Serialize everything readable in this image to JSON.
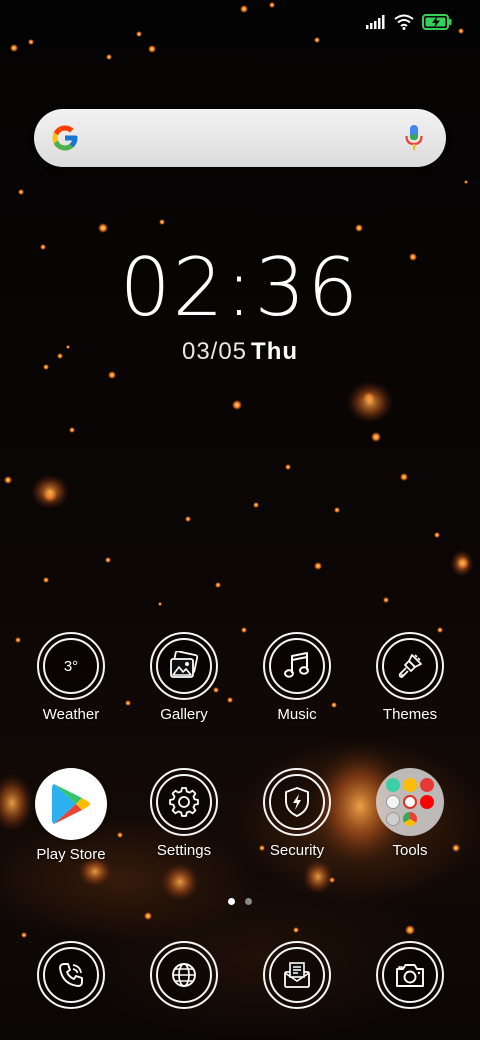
{
  "status_bar": {
    "signal_icon": "signal-bars-icon",
    "wifi_icon": "wifi-icon",
    "battery_icon": "battery-charging-icon",
    "battery_color": "#35d05a"
  },
  "search": {
    "logo_icon": "google-g-icon",
    "mic_icon": "microphone-icon"
  },
  "clock": {
    "time": "02:36",
    "date": "03/05",
    "day": "Thu"
  },
  "apps": {
    "weather": {
      "label": "Weather",
      "icon_text": "3°"
    },
    "gallery": {
      "label": "Gallery",
      "icon": "image-icon"
    },
    "music": {
      "label": "Music",
      "icon": "music-note-icon"
    },
    "themes": {
      "label": "Themes",
      "icon": "paintbrush-icon"
    },
    "playstore": {
      "label": "Play Store",
      "icon": "play-store-icon"
    },
    "settings": {
      "label": "Settings",
      "icon": "gear-icon"
    },
    "security": {
      "label": "Security",
      "icon": "shield-bolt-icon"
    },
    "tools": {
      "label": "Tools",
      "icon": "folder-icon"
    }
  },
  "dock": [
    {
      "icon": "phone-icon"
    },
    {
      "icon": "globe-icon"
    },
    {
      "icon": "messages-icon"
    },
    {
      "icon": "camera-icon"
    }
  ],
  "pages": {
    "count": 2,
    "current": 1
  },
  "colors": {
    "lantern_glow": "#ff8a2a",
    "icon_stroke": "#f4f4f4",
    "dot_active": "#ffffff",
    "dot_inactive": "#8a8a8a"
  }
}
